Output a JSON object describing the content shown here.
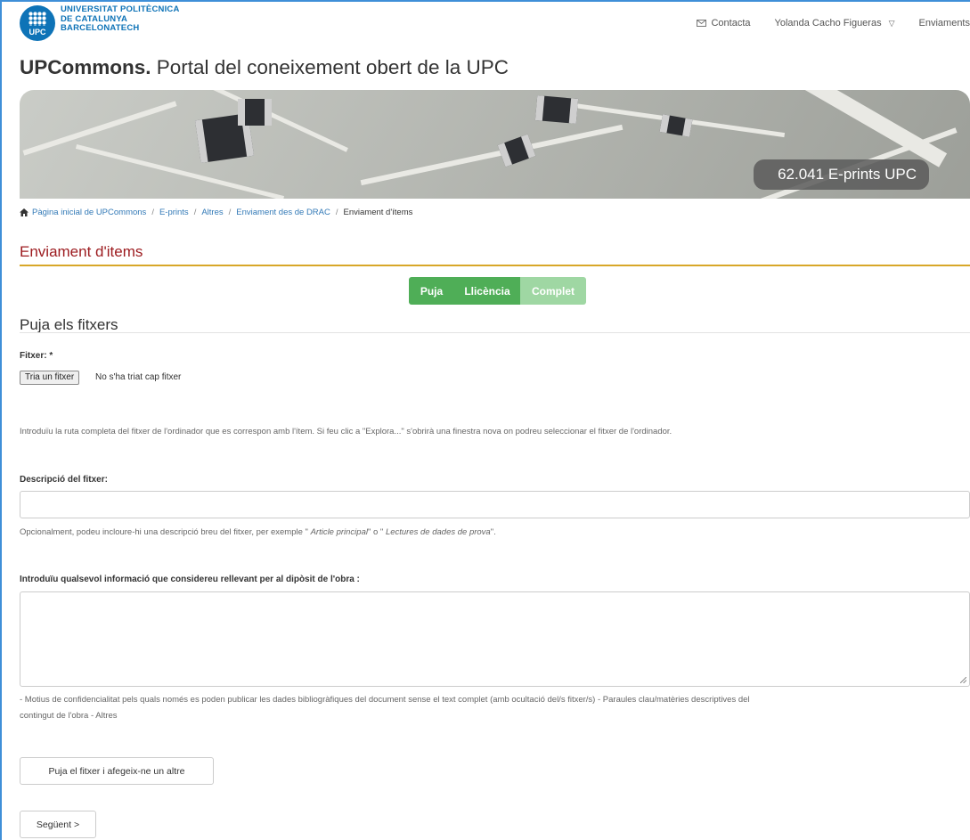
{
  "header": {
    "logo_lines": [
      "UNIVERSITAT POLITÈCNICA",
      "DE CATALUNYA",
      "BARCELONATECH"
    ],
    "logo_mark": "UPC",
    "nav": {
      "contact": "Contacta",
      "user": "Yolanda Cacho Figueras",
      "submissions": "Enviaments"
    },
    "icons": {
      "contact": "mail-icon",
      "user_menu": "triangle-down-icon"
    }
  },
  "site_title": {
    "bold": "UPCommons.",
    "rest": " Portal del coneixement obert de la UPC"
  },
  "banner": {
    "badge": "62.041 E-prints UPC"
  },
  "breadcrumb": {
    "items": [
      "Pàgina inicial de UPCommons",
      "E-prints",
      "Altres",
      "Enviament des de DRAC"
    ],
    "current": "Enviament d'ítems",
    "separator": "/"
  },
  "page_heading": "Enviament d'items",
  "steps": [
    "Puja",
    "Llicència",
    "Complet"
  ],
  "section_title": "Puja els fitxers",
  "file": {
    "label": "Fitxer: *",
    "button": "Tria un fitxer",
    "status": "No s'ha triat cap fitxer",
    "help": "Introduïu la ruta completa del fitxer de l'ordinador que es correspon amb l'ítem. Si feu clic a \"Explora...\" s'obrirà una finestra nova on podreu seleccionar el fitxer de l'ordinador."
  },
  "description": {
    "label": "Descripció del fitxer:",
    "value": "",
    "help_pre": "Opcionalment, podeu incloure-hi una descripció breu del fitxer, per exemple \" ",
    "help_ex1": "Article principal",
    "help_mid": "\" o \" ",
    "help_ex2": "Lectures de dades de prova",
    "help_post": "\"."
  },
  "info": {
    "label": "Introduïu qualsevol informació que considereu rellevant per al dipòsit de l'obra :",
    "value": "",
    "help_line1": "- Motius de confidencialitat pels quals només es poden publicar les dades bibliogràfiques del document sense el text complet (amb ocultació del/s fitxer/s) - Paraules clau/matèries descriptives del",
    "help_line2": "contingut de l'obra - Altres"
  },
  "buttons": {
    "upload_more": "Puja el fitxer i afegeix-ne un altre",
    "next": "Següent >"
  },
  "colors": {
    "brand_blue": "#0e73b7",
    "heading_red": "#9c1a1e",
    "step_green": "#4fae57",
    "rule_gold": "#d8a729"
  }
}
